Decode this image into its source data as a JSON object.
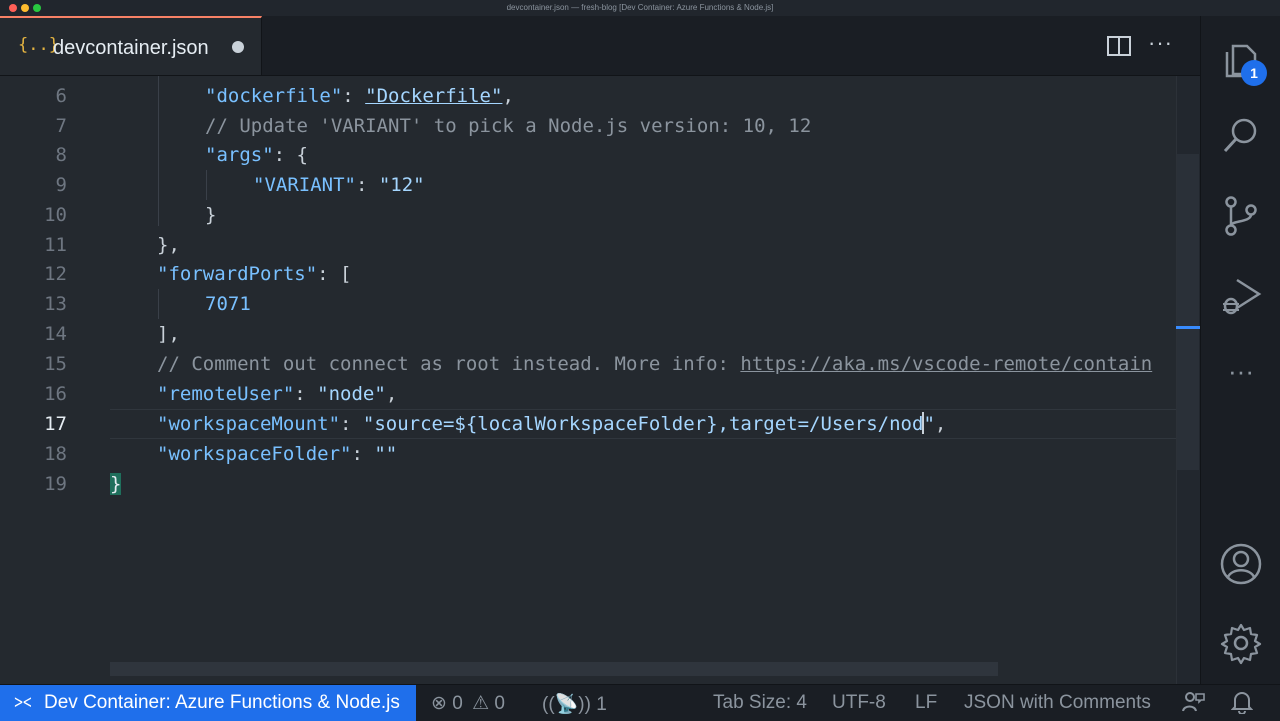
{
  "window": {
    "title": "devcontainer.json — fresh-blog [Dev Container: Azure Functions & Node.js]"
  },
  "tab": {
    "icon": "{..}",
    "label": "devcontainer.json",
    "dirty": true
  },
  "editor": {
    "line_numbers": [
      "6",
      "7",
      "8",
      "9",
      "10",
      "11",
      "12",
      "13",
      "14",
      "15",
      "16",
      "17",
      "18",
      "19"
    ],
    "active_line": "17",
    "lines": {
      "l6": {
        "key": "\"dockerfile\"",
        "p1": ": ",
        "val": "\"Dockerfile\"",
        "p2": ","
      },
      "l7": {
        "comment": "// Update 'VARIANT' to pick a Node.js version: 10, 12"
      },
      "l8": {
        "key": "\"args\"",
        "p1": ": {"
      },
      "l9": {
        "key": "\"VARIANT\"",
        "p1": ": ",
        "val": "\"12\""
      },
      "l10": {
        "text": "}"
      },
      "l11": {
        "text": "},"
      },
      "l12": {
        "key": "\"forwardPorts\"",
        "p1": ": ["
      },
      "l13": {
        "num": "7071"
      },
      "l14": {
        "text": "],"
      },
      "l15": {
        "comment": "// Comment out connect as root instead. More info: ",
        "link": "https://aka.ms/vscode-remote/contain"
      },
      "l16": {
        "key": "\"remoteUser\"",
        "p1": ": ",
        "val": "\"node\"",
        "p2": ","
      },
      "l17": {
        "key": "\"workspaceMount\"",
        "p1": ": ",
        "val_a": "\"source=${localWorkspaceFolder},target=/Users/nod",
        "val_b": "\"",
        "p2": ","
      },
      "l18": {
        "key": "\"workspaceFolder\"",
        "p1": ": ",
        "val": "\"\""
      },
      "l19": {
        "text": "}"
      }
    }
  },
  "activity_bar": {
    "items": [
      "explorer-icon",
      "search-icon",
      "source-control-icon",
      "run-debug-icon",
      "more-icon",
      "account-icon",
      "settings-gear-icon"
    ],
    "explorer_badge": "1"
  },
  "status_bar": {
    "remote_label": "Dev Container: Azure Functions & Node.js",
    "errors": "0",
    "warnings": "0",
    "ports": "1",
    "tab_size": "Tab Size: 4",
    "encoding": "UTF-8",
    "eol": "LF",
    "language": "JSON with Comments"
  },
  "colors": {
    "accent": "#1f6feb",
    "editor_bg": "#24292f",
    "string": "#a5d6ff",
    "key": "#79c0ff",
    "comment": "#8b949e"
  }
}
